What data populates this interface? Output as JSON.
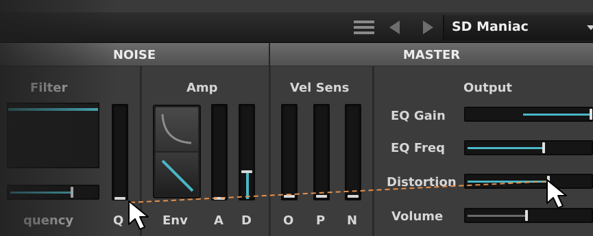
{
  "toolbar": {
    "preset_name": "SD Maniac"
  },
  "sections": {
    "noise": "NOISE",
    "master": "MASTER"
  },
  "noise": {
    "filter_label": "Filter",
    "amp_label": "Amp",
    "q_label": "Q",
    "frequency_label": "quency",
    "env_label": "Env",
    "a_label": "A",
    "d_label": "D",
    "frequency_level": 0.7,
    "q_level": 0.0,
    "a_level": 0.0,
    "d_level": 0.3
  },
  "master": {
    "vel_sens_label": "Vel Sens",
    "output_label": "Output",
    "o_label": "O",
    "p_label": "P",
    "n_label": "N",
    "eq_gain_label": "EQ Gain",
    "eq_freq_label": "EQ Freq",
    "distortion_label": "Distortion",
    "volume_label": "Volume",
    "eq_gain_level": 1.0,
    "eq_freq_level": 0.61,
    "distortion_level": 0.65,
    "volume_level": 0.47
  },
  "colors": {
    "accent": "#4ab8c8",
    "drag_line": "#e8904a"
  },
  "icons": {
    "menu": "hamburger-menu-icon",
    "prev": "left-arrow-icon",
    "next": "right-arrow-icon",
    "dropdown": "caret-down-icon",
    "cursor": "mouse-pointer-icon"
  }
}
